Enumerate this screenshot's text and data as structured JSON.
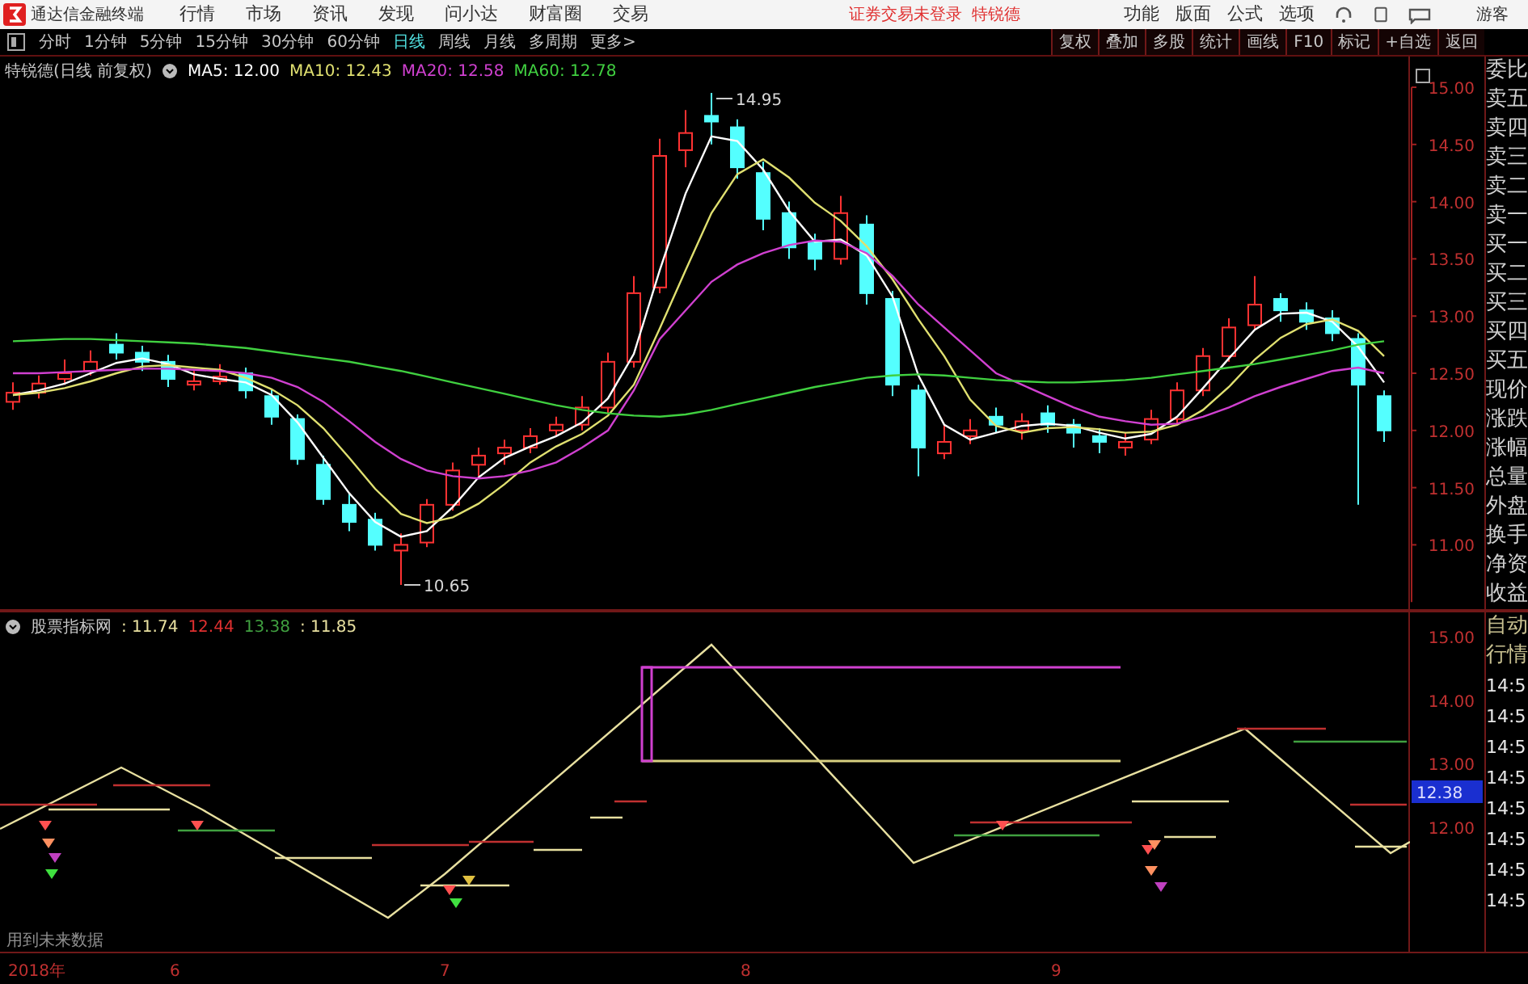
{
  "title_bar": {
    "app_name": "通达信金融终端",
    "menus": [
      "行情",
      "市场",
      "资讯",
      "发现",
      "问小达",
      "财富圈",
      "交易"
    ],
    "login_status": "证券交易未登录",
    "stock_name": "特锐德",
    "tools": [
      "功能",
      "版面",
      "公式",
      "选项"
    ],
    "user": "游客"
  },
  "period_tabs": [
    {
      "label": "分时",
      "selected": false
    },
    {
      "label": "1分钟",
      "selected": false
    },
    {
      "label": "5分钟",
      "selected": false
    },
    {
      "label": "15分钟",
      "selected": false
    },
    {
      "label": "30分钟",
      "selected": false
    },
    {
      "label": "60分钟",
      "selected": false
    },
    {
      "label": "日线",
      "selected": true
    },
    {
      "label": "周线",
      "selected": false
    },
    {
      "label": "月线",
      "selected": false
    },
    {
      "label": "多周期",
      "selected": false
    }
  ],
  "more_button": "更多>",
  "actions": [
    "复权",
    "叠加",
    "多股",
    "统计",
    "画线",
    "F10",
    "标记",
    "+自选",
    "返回"
  ],
  "main_chart": {
    "title": "特锐德(日线 前复权)",
    "ma_values": [
      ": 12.00",
      ": 12.43",
      ": 12.58",
      ": 12.78"
    ],
    "high_label": "14.95",
    "low_label": "10.65",
    "chart_data": {
      "type": "candlestick",
      "ylim": [
        10.5,
        15
      ],
      "yticks": [
        {
          "value": 15,
          "label": "15.00"
        },
        {
          "value": 14.5,
          "label": "14.50"
        },
        {
          "value": 14,
          "label": "14.00"
        },
        {
          "value": 13.5,
          "label": "13.50"
        },
        {
          "value": 13,
          "label": "13.00"
        },
        {
          "value": 12.5,
          "label": "12.50"
        },
        {
          "value": 12,
          "label": "12.00"
        },
        {
          "value": 11.5,
          "label": "11.50"
        },
        {
          "value": 11,
          "label": "11.00"
        }
      ],
      "ohlc": [
        [
          12.25,
          12.42,
          12.18,
          12.33
        ],
        [
          12.33,
          12.48,
          12.28,
          12.41
        ],
        [
          12.45,
          12.62,
          12.4,
          12.5
        ],
        [
          12.52,
          12.7,
          12.48,
          12.6
        ],
        [
          12.75,
          12.85,
          12.62,
          12.68
        ],
        [
          12.68,
          12.74,
          12.52,
          12.6
        ],
        [
          12.6,
          12.66,
          12.38,
          12.45
        ],
        [
          12.4,
          12.52,
          12.35,
          12.43
        ],
        [
          12.43,
          12.58,
          12.4,
          12.47
        ],
        [
          12.5,
          12.55,
          12.28,
          12.35
        ],
        [
          12.3,
          12.36,
          12.05,
          12.12
        ],
        [
          12.1,
          12.14,
          11.7,
          11.75
        ],
        [
          11.7,
          11.78,
          11.35,
          11.4
        ],
        [
          11.35,
          11.45,
          11.12,
          11.2
        ],
        [
          11.22,
          11.28,
          10.95,
          11.0
        ],
        [
          10.95,
          11.1,
          10.65,
          11.0
        ],
        [
          11.02,
          11.4,
          10.98,
          11.35
        ],
        [
          11.35,
          11.72,
          11.3,
          11.65
        ],
        [
          11.7,
          11.85,
          11.6,
          11.78
        ],
        [
          11.8,
          11.92,
          11.7,
          11.85
        ],
        [
          11.85,
          12.02,
          11.8,
          11.95
        ],
        [
          12.0,
          12.12,
          11.95,
          12.05
        ],
        [
          12.05,
          12.3,
          12.0,
          12.2
        ],
        [
          12.2,
          12.68,
          12.15,
          12.6
        ],
        [
          12.6,
          13.35,
          12.55,
          13.2
        ],
        [
          13.25,
          14.55,
          13.2,
          14.4
        ],
        [
          14.45,
          14.8,
          14.3,
          14.6
        ],
        [
          14.75,
          14.95,
          14.5,
          14.7
        ],
        [
          14.65,
          14.72,
          14.2,
          14.3
        ],
        [
          14.25,
          14.35,
          13.75,
          13.85
        ],
        [
          13.9,
          14.0,
          13.5,
          13.6
        ],
        [
          13.65,
          13.72,
          13.4,
          13.5
        ],
        [
          13.5,
          14.05,
          13.45,
          13.9
        ],
        [
          13.8,
          13.88,
          13.1,
          13.2
        ],
        [
          13.15,
          13.22,
          12.3,
          12.4
        ],
        [
          12.35,
          12.4,
          11.6,
          11.85
        ],
        [
          11.8,
          12.05,
          11.75,
          11.9
        ],
        [
          11.95,
          12.1,
          11.88,
          12.0
        ],
        [
          12.12,
          12.2,
          11.98,
          12.05
        ],
        [
          12.0,
          12.15,
          11.92,
          12.08
        ],
        [
          12.15,
          12.22,
          11.98,
          12.05
        ],
        [
          12.05,
          12.1,
          11.85,
          11.98
        ],
        [
          11.95,
          12.02,
          11.8,
          11.9
        ],
        [
          11.85,
          11.98,
          11.78,
          11.9
        ],
        [
          11.92,
          12.18,
          11.88,
          12.1
        ],
        [
          12.1,
          12.42,
          12.05,
          12.35
        ],
        [
          12.35,
          12.72,
          12.3,
          12.65
        ],
        [
          12.65,
          12.98,
          12.6,
          12.9
        ],
        [
          12.92,
          13.35,
          12.88,
          13.1
        ],
        [
          13.15,
          13.2,
          12.95,
          13.05
        ],
        [
          13.05,
          13.12,
          12.88,
          12.95
        ],
        [
          12.98,
          13.05,
          12.78,
          12.85
        ],
        [
          12.8,
          12.85,
          11.35,
          12.4
        ],
        [
          12.3,
          12.35,
          11.9,
          12.0
        ]
      ],
      "series": [
        {
          "name": "MA5",
          "type": "line",
          "color": "#ffffff",
          "values": [
            12.31,
            12.35,
            12.41,
            12.5,
            12.59,
            12.63,
            12.58,
            12.49,
            12.45,
            12.42,
            12.31,
            12.07,
            11.76,
            11.45,
            11.2,
            11.07,
            11.12,
            11.33,
            11.59,
            11.76,
            11.86,
            11.95,
            12.07,
            12.28,
            12.67,
            13.4,
            14.07,
            14.57,
            14.53,
            14.28,
            13.92,
            13.65,
            13.67,
            13.53,
            13.17,
            12.48,
            12.05,
            11.92,
            11.98,
            12.04,
            12.06,
            12.04,
            11.98,
            11.93,
            11.97,
            12.12,
            12.37,
            12.63,
            12.88,
            13.02,
            13.03,
            12.95,
            12.73,
            12.42
          ]
        },
        {
          "name": "MA10",
          "type": "line",
          "color": "#e0e070",
          "values": [
            12.31,
            12.33,
            12.37,
            12.43,
            12.5,
            12.56,
            12.57,
            12.55,
            12.53,
            12.46,
            12.36,
            12.22,
            12.02,
            11.76,
            11.49,
            11.27,
            11.19,
            11.24,
            11.36,
            11.53,
            11.72,
            11.86,
            11.97,
            12.13,
            12.4,
            12.89,
            13.4,
            13.9,
            14.24,
            14.37,
            14.21,
            13.99,
            13.83,
            13.61,
            13.32,
            12.97,
            12.65,
            12.27,
            12.04,
            11.98,
            12.02,
            12.03,
            12.01,
            11.98,
            11.99,
            12.05,
            12.18,
            12.38,
            12.62,
            12.81,
            12.93,
            12.97,
            12.87,
            12.65
          ]
        },
        {
          "name": "MA20",
          "type": "line",
          "color": "#d040d0",
          "values": [
            12.5,
            12.5,
            12.51,
            12.52,
            12.53,
            12.54,
            12.54,
            12.53,
            12.52,
            12.5,
            12.46,
            12.38,
            12.25,
            12.08,
            11.9,
            11.75,
            11.65,
            11.6,
            11.58,
            11.6,
            11.65,
            11.72,
            11.85,
            12.0,
            12.35,
            12.8,
            13.05,
            13.3,
            13.45,
            13.55,
            13.62,
            13.66,
            13.65,
            13.55,
            13.35,
            13.1,
            12.9,
            12.7,
            12.5,
            12.4,
            12.3,
            12.2,
            12.12,
            12.08,
            12.05,
            12.06,
            12.12,
            12.2,
            12.3,
            12.38,
            12.45,
            12.52,
            12.55,
            12.5
          ]
        },
        {
          "name": "MA60",
          "type": "line",
          "color": "#40d040",
          "values": [
            12.78,
            12.79,
            12.8,
            12.8,
            12.79,
            12.78,
            12.77,
            12.76,
            12.74,
            12.72,
            12.69,
            12.66,
            12.63,
            12.6,
            12.56,
            12.52,
            12.47,
            12.42,
            12.37,
            12.32,
            12.27,
            12.22,
            12.18,
            12.15,
            12.13,
            12.12,
            12.14,
            12.18,
            12.23,
            12.28,
            12.33,
            12.38,
            12.42,
            12.46,
            12.48,
            12.49,
            12.48,
            12.46,
            12.44,
            12.43,
            12.42,
            12.42,
            12.43,
            12.44,
            12.46,
            12.49,
            12.52,
            12.55,
            12.58,
            12.62,
            12.66,
            12.7,
            12.75,
            12.78
          ]
        }
      ]
    }
  },
  "quote_panel_labels": [
    "委比",
    "卖五",
    "卖四",
    "卖三",
    "卖二",
    "卖一",
    "买一",
    "买二",
    "买三",
    "买四",
    "买五",
    "现价",
    "涨跌",
    "涨幅",
    "总量",
    "外盘",
    "换手",
    "净资",
    "收益"
  ],
  "indicator": {
    "name": "股票指标网",
    "values": [
      {
        "text": ": 11.74",
        "color": "#e8e0a0"
      },
      {
        "text": "12.44",
        "color": "#e03030"
      },
      {
        "text": "13.38",
        "color": "#40a040"
      },
      {
        "text": ": 11.85",
        "color": "#e8e0a0"
      }
    ],
    "ticks": [
      "15.00",
      "14.00",
      "13.00",
      "12.00"
    ],
    "current": "12.38",
    "note": "用到未来数据"
  },
  "side_tabs": [
    "自动",
    "行情"
  ],
  "trade_times": [
    "14:5",
    "14:5",
    "14:5",
    "14:5",
    "14:5",
    "14:5",
    "14:5",
    "14:5"
  ],
  "date_axis": [
    "2018年",
    "6",
    "7",
    "8",
    "9"
  ]
}
